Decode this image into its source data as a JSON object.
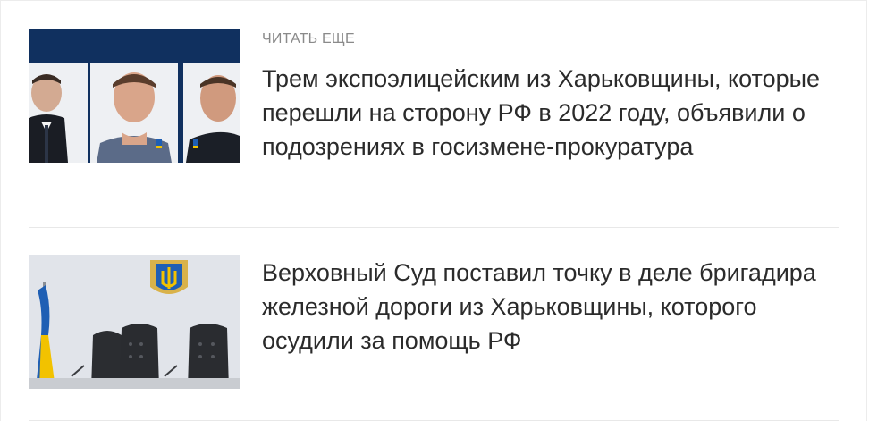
{
  "section": {
    "kicker": "ЧИТАТЬ ЕЩЕ"
  },
  "articles": [
    {
      "title": "Трем экспоэлицейским из Харьковщины, которые перешли на сторону РФ в 2022 году, объявили о подозрениях в госизмене-прокуратура",
      "image": "mugshots-photo"
    },
    {
      "title": "Верховный Суд поставил точку в деле бригадира железной дороги из Харьковщины, которого осудили за помощь РФ",
      "image": "courtroom-photo"
    }
  ],
  "colors": {
    "kicker": "#8a8a8a",
    "headline": "#2b2b2b",
    "divider": "#e8e8e8",
    "photo_bg_navy": "#10305f",
    "flag_blue": "#1f5fb4",
    "flag_yellow": "#f2c200"
  }
}
